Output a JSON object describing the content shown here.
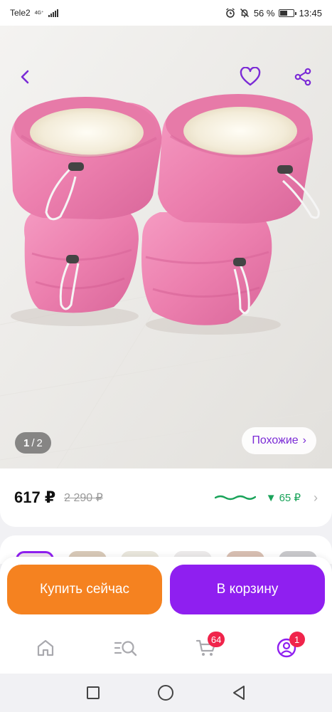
{
  "status_bar": {
    "carrier": "Tele2",
    "network": "4G⁺",
    "battery_percent": "56 %",
    "time": "13:45"
  },
  "gallery": {
    "current": "1",
    "separator": "/",
    "total": "2",
    "similar_label": "Похожие",
    "similar_chevron": "›",
    "icons": [
      "back-icon",
      "heart-icon",
      "share-icon"
    ]
  },
  "price": {
    "current": "617 ₽",
    "old": "2 290 ₽",
    "discount_arrow": "▼",
    "discount": "65 ₽",
    "chevron": "›",
    "colors": {
      "discount": "#1aa35a",
      "wave": "#1aa35a"
    }
  },
  "actions": {
    "buy_now": "Купить сейчас",
    "add_to_cart": "В корзину",
    "colors": {
      "buy_now": "#f58220",
      "add_to_cart": "#8f1ff0"
    }
  },
  "bottom_nav": {
    "items": [
      {
        "name": "home",
        "icon": "home-icon"
      },
      {
        "name": "catalog",
        "icon": "catalog-search-icon"
      },
      {
        "name": "cart",
        "icon": "cart-icon",
        "badge": "64"
      },
      {
        "name": "profile",
        "icon": "profile-icon",
        "badge": "1"
      }
    ]
  },
  "accent_color": "#7b2bd6"
}
